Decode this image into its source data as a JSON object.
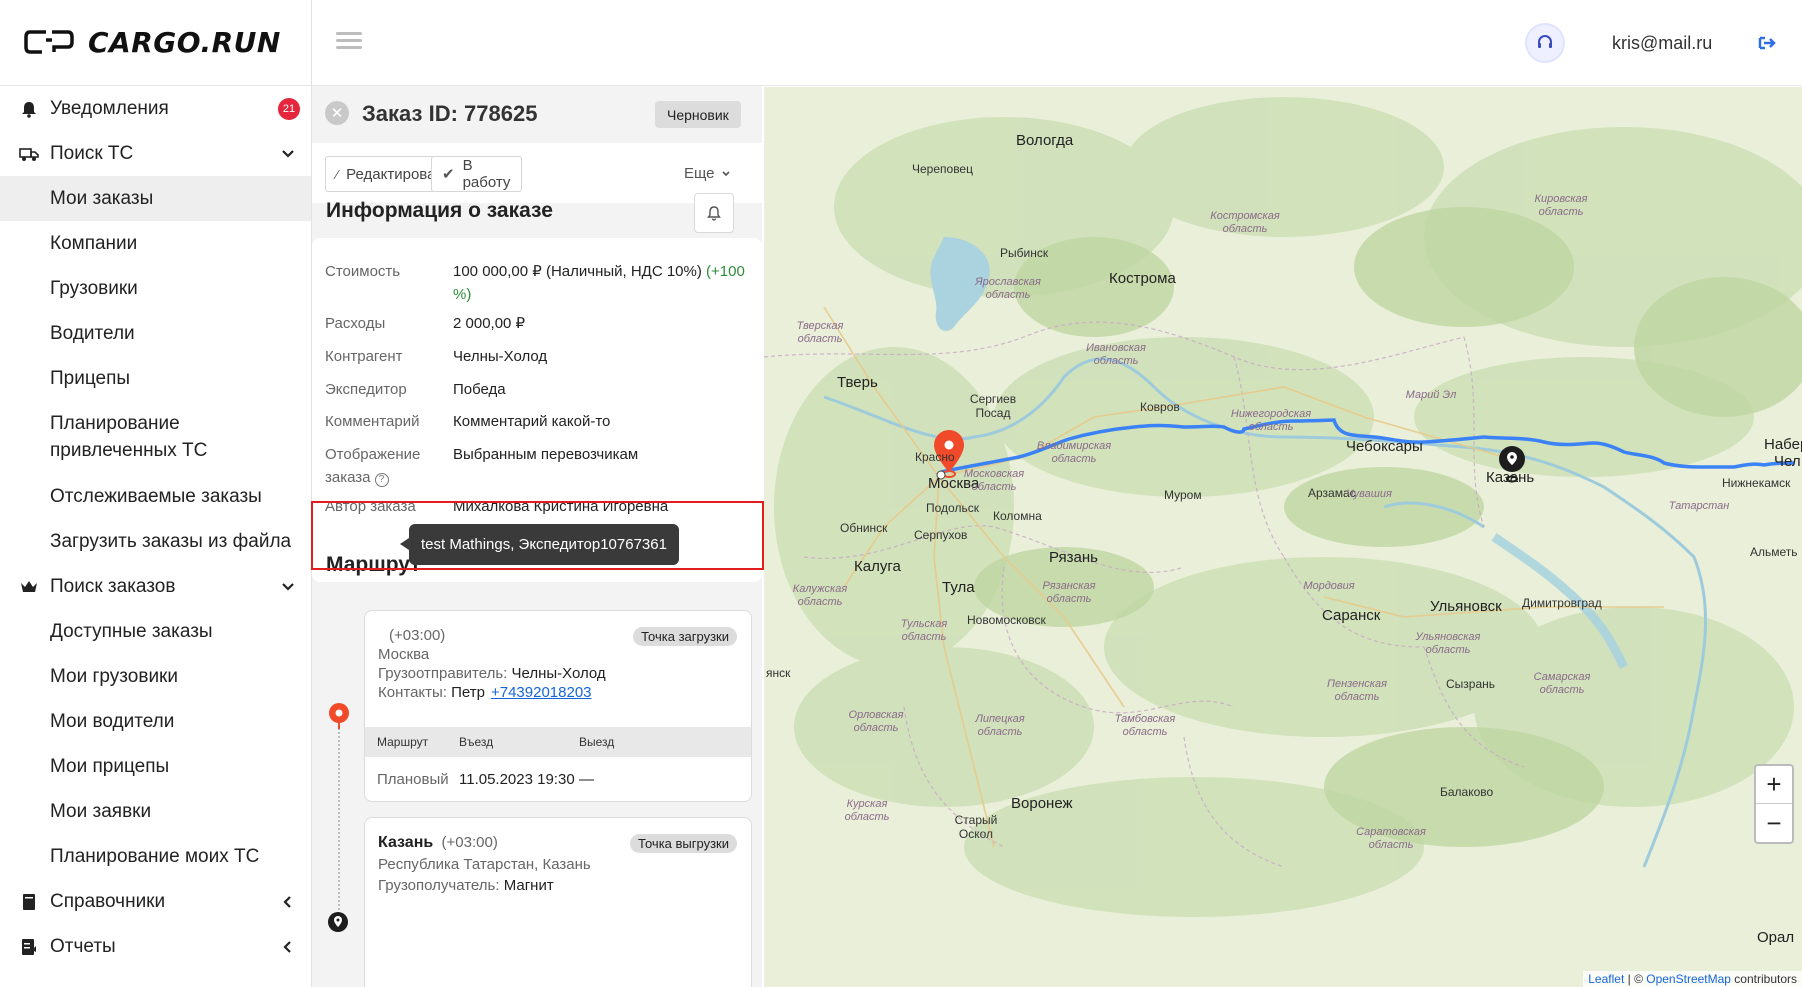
{
  "header": {
    "logo_text": "CARGO.RUN",
    "user_email": "kris@mail.ru"
  },
  "sidebar": {
    "items": [
      {
        "label": "Уведомления",
        "icon": "bell-icon",
        "badge": "21"
      },
      {
        "label": "Поиск ТС",
        "icon": "truck-icon",
        "expanded": true
      },
      {
        "label": "Мои заказы",
        "active": true
      },
      {
        "label": "Компании"
      },
      {
        "label": "Грузовики"
      },
      {
        "label": "Водители"
      },
      {
        "label": "Прицепы"
      },
      {
        "label": "Планирование привлеченных ТС"
      },
      {
        "label": "Отслеживаемые заказы"
      },
      {
        "label": "Загрузить заказы из файла"
      },
      {
        "label": "Поиск заказов",
        "icon": "crown-icon",
        "expanded": true
      },
      {
        "label": "Доступные заказы"
      },
      {
        "label": "Мои грузовики"
      },
      {
        "label": "Мои водители"
      },
      {
        "label": "Мои прицепы"
      },
      {
        "label": "Мои заявки"
      },
      {
        "label": "Планирование моих ТС"
      },
      {
        "label": "Справочники",
        "icon": "book-icon"
      },
      {
        "label": "Отчеты",
        "icon": "report-icon"
      }
    ]
  },
  "order": {
    "title": "Заказ ID: 778625",
    "status": "Черновик",
    "edit_label": "Редактировать",
    "to_work_label": "В работу",
    "more_label": "Еще",
    "info_title": "Информация о заказе",
    "info": [
      {
        "key": "Стоимость",
        "value": "100 000,00 ₽ (Наличный, НДС 10%)",
        "extra": "(+100 %)"
      },
      {
        "key": "Расходы",
        "value": "2 000,00 ₽"
      },
      {
        "key": "Контрагент",
        "value": "Челны-Холод"
      },
      {
        "key": "Экспедитор",
        "value": "Победа"
      },
      {
        "key": "Комментарий",
        "value": "Комментарий какой-то"
      },
      {
        "key": "Отображение заказа",
        "value": "Выбранным перевозчикам"
      },
      {
        "key": "Автор заказа",
        "value": "Михалкова Кристина Игоревна"
      }
    ],
    "tooltip": "test Mathings, Экспедитор10767361",
    "route_title": "Маршрут",
    "stops": [
      {
        "tz": "(+03:00)",
        "city": "Москва",
        "tag": "Точка загрузки",
        "party_label": "Грузоотправитель:",
        "party": "Челны-Холод",
        "contacts_label": "Контакты:",
        "contact_name": "Петр",
        "phone": "+74392018203",
        "cols": [
          "Маршрут",
          "Въезд",
          "Выезд"
        ],
        "row_label": "Плановый",
        "row_in": "11.05.2023 19:30",
        "row_out": "—"
      },
      {
        "name": "Казань",
        "tz": "(+03:00)",
        "tag": "Точка выгрузки",
        "address": "Республика Татарстан, Казань",
        "party_label": "Грузополучатель:",
        "party": "Магнит"
      }
    ]
  },
  "map": {
    "cities": [
      "Вологда",
      "Череповец",
      "Рыбинск",
      "Кострома",
      "Тверь",
      "Сергиев Посад",
      "Ковров",
      "Красно",
      "Москва",
      "Подольск",
      "Муром",
      "Арзамас",
      "Коломна",
      "Обнинск",
      "Серпухов",
      "Рязань",
      "Калуга",
      "Тула",
      "Новомосковск",
      "Саранск",
      "Чебоксары",
      "Казань",
      "Ульяновск",
      "Димитровград",
      "Сызрань",
      "Воронеж",
      "Старый Оскол",
      "Балаково",
      "Нижнекамск",
      "Альметь",
      "Набере",
      "Чел",
      "Орал",
      "янск"
    ],
    "regions": [
      "Костромская область",
      "Кировская область",
      "Ярославская область",
      "Тверская область",
      "Ивановская область",
      "Марий Эл",
      "Нижегородская область",
      "Владимирская область",
      "Московская область",
      "Чувашия",
      "Татарстан",
      "Калужская область",
      "Рязанская область",
      "Мордовия",
      "Тульская область",
      "Ульяновская область",
      "Пензенская область",
      "Самарская область",
      "Орловская область",
      "Липецкая область",
      "Тамбовская область",
      "Курская область",
      "Саратовская область"
    ],
    "zoom_in": "+",
    "zoom_out": "−",
    "attribution_leaflet": "Leaflet",
    "attribution_sep": " | © ",
    "attribution_osm": "OpenStreetMap",
    "attribution_tail": " contributors",
    "route_color": "#3b82f6"
  }
}
